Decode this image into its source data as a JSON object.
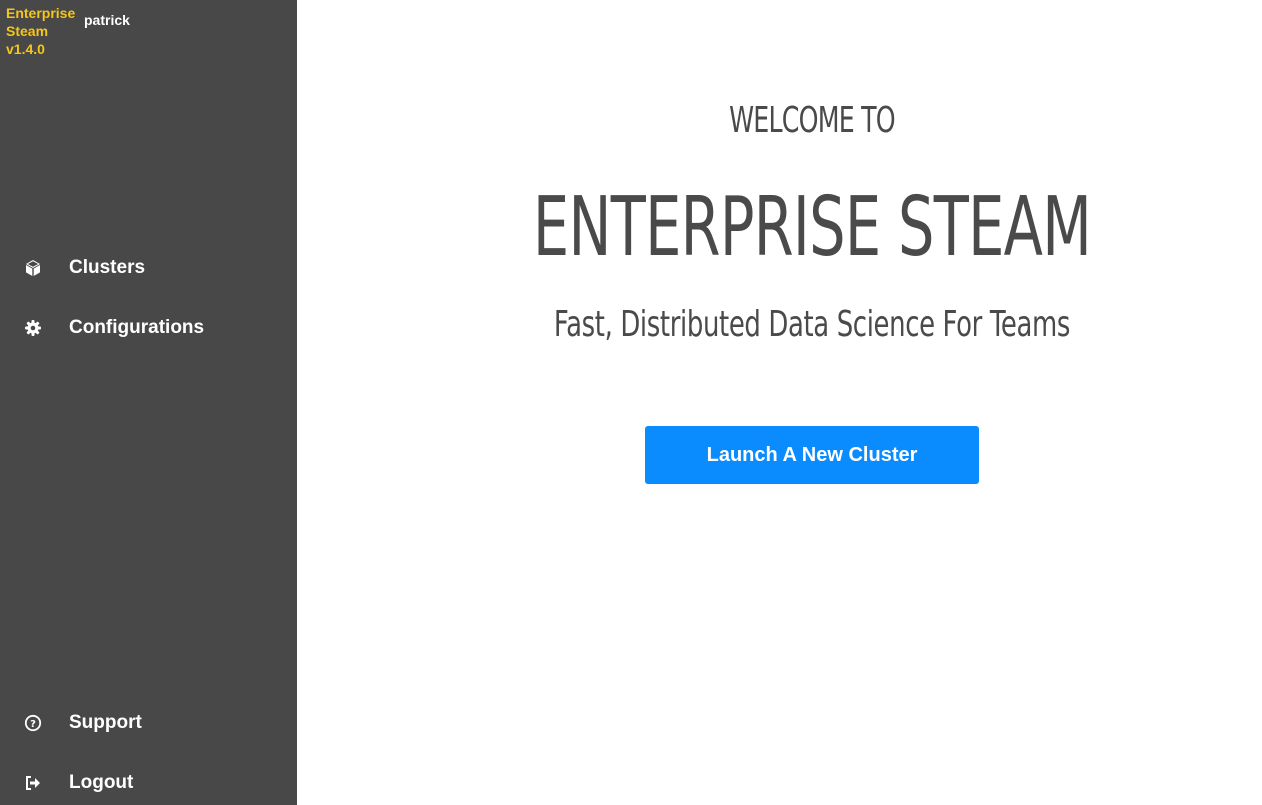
{
  "sidebar": {
    "brand": {
      "line1": "Enterprise",
      "line2": "Steam",
      "version": "v1.4.0",
      "color": "#f5c518"
    },
    "username": "patrick",
    "nav": [
      {
        "label": "Clusters",
        "icon": "cube-icon"
      },
      {
        "label": "Configurations",
        "icon": "gear-icon"
      }
    ],
    "footer_nav": [
      {
        "label": "Support",
        "icon": "question-circle-icon"
      },
      {
        "label": "Logout",
        "icon": "sign-out-icon"
      }
    ],
    "background": "#484848"
  },
  "main": {
    "welcome": "WELCOME TO",
    "title": "ENTERPRISE STEAM",
    "subtitle": "Fast, Distributed Data Science For Teams",
    "launch_button": "Launch A New Cluster",
    "accent": "#0a8cff"
  }
}
